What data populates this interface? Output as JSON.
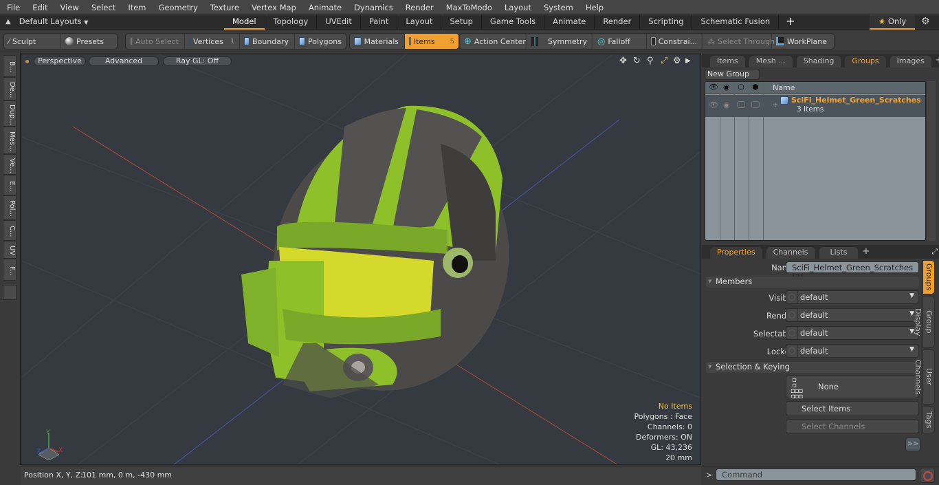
{
  "menubar": [
    "File",
    "Edit",
    "View",
    "Select",
    "Item",
    "Geometry",
    "Texture",
    "Vertex Map",
    "Animate",
    "Dynamics",
    "Render",
    "MaxToModo",
    "Layout",
    "System",
    "Help"
  ],
  "layouts": {
    "dropdown_label": "Default Layouts",
    "tabs": [
      "Model",
      "Topology",
      "UVEdit",
      "Paint",
      "Layout",
      "Setup",
      "Game Tools",
      "Animate",
      "Render",
      "Scripting",
      "Schematic Fusion"
    ],
    "active_tab": "Model",
    "only_label": "Only"
  },
  "toolbar": {
    "sculpt": "Sculpt",
    "presets": "Presets",
    "auto_select": "Auto Select",
    "vertices": "Vertices",
    "vertices_count": "1",
    "boundary": "Boundary",
    "polygons": "Polygons",
    "materials": "Materials",
    "items": "Items",
    "items_count": "5",
    "action_center": "Action Center",
    "symmetry": "Symmetry",
    "falloff": "Falloff",
    "constraints": "Constrai...",
    "select_through": "Select Through",
    "workplane": "WorkPlane"
  },
  "left_strip": [
    "B...",
    "De...",
    "Dup...",
    "Mes...",
    "Ve...",
    "E...",
    "Pol...",
    "C...",
    "UV",
    "F..."
  ],
  "viewport": {
    "view_mode": "Perspective",
    "shading": "Advanced",
    "raygl": "Ray GL: Off",
    "hud": {
      "selection": "No Items",
      "polygons": "Polygons : Face",
      "channels": "Channels: 0",
      "deformers": "Deformers: ON",
      "gl": "GL: 43,236",
      "grid": "20 mm"
    },
    "axis": {
      "x": "X",
      "y": "Y",
      "z": "Z"
    }
  },
  "status": {
    "label": "Position X, Y, Z:",
    "value": "101 mm, 0 m, -430 mm"
  },
  "groups_panel": {
    "tabs": [
      "Items",
      "Mesh ...",
      "Shading",
      "Groups",
      "Images"
    ],
    "active_tab": "Groups",
    "new_group": "New Group",
    "column_name": "Name",
    "group": {
      "name": "SciFi_Helmet_Green_Scratches",
      "count": "3 Items"
    }
  },
  "properties_panel": {
    "tabs": [
      "Properties",
      "Channels",
      "Lists"
    ],
    "active_tab": "Properties",
    "name_label": "Name",
    "name_value": "SciFi_Helmet_Green_Scratches (3)",
    "members_section": "Members",
    "fields": [
      {
        "label": "Visible",
        "value": "default"
      },
      {
        "label": "Render",
        "value": "default"
      },
      {
        "label": "Selectable",
        "value": "default"
      },
      {
        "label": "Locked",
        "value": "default"
      }
    ],
    "selection_section": "Selection & Keying",
    "none_label": "None",
    "select_items": "Select Items",
    "select_channels": "Select Channels",
    "more": ">>",
    "side_tabs": [
      "Groups",
      "Group Display",
      "User Channels",
      "Tags"
    ]
  },
  "command": {
    "prompt": ">",
    "placeholder": "Command"
  },
  "colors": {
    "accent": "#f0a030",
    "group_name": "#f2a43a",
    "hud_highlight": "#f2c04a"
  }
}
